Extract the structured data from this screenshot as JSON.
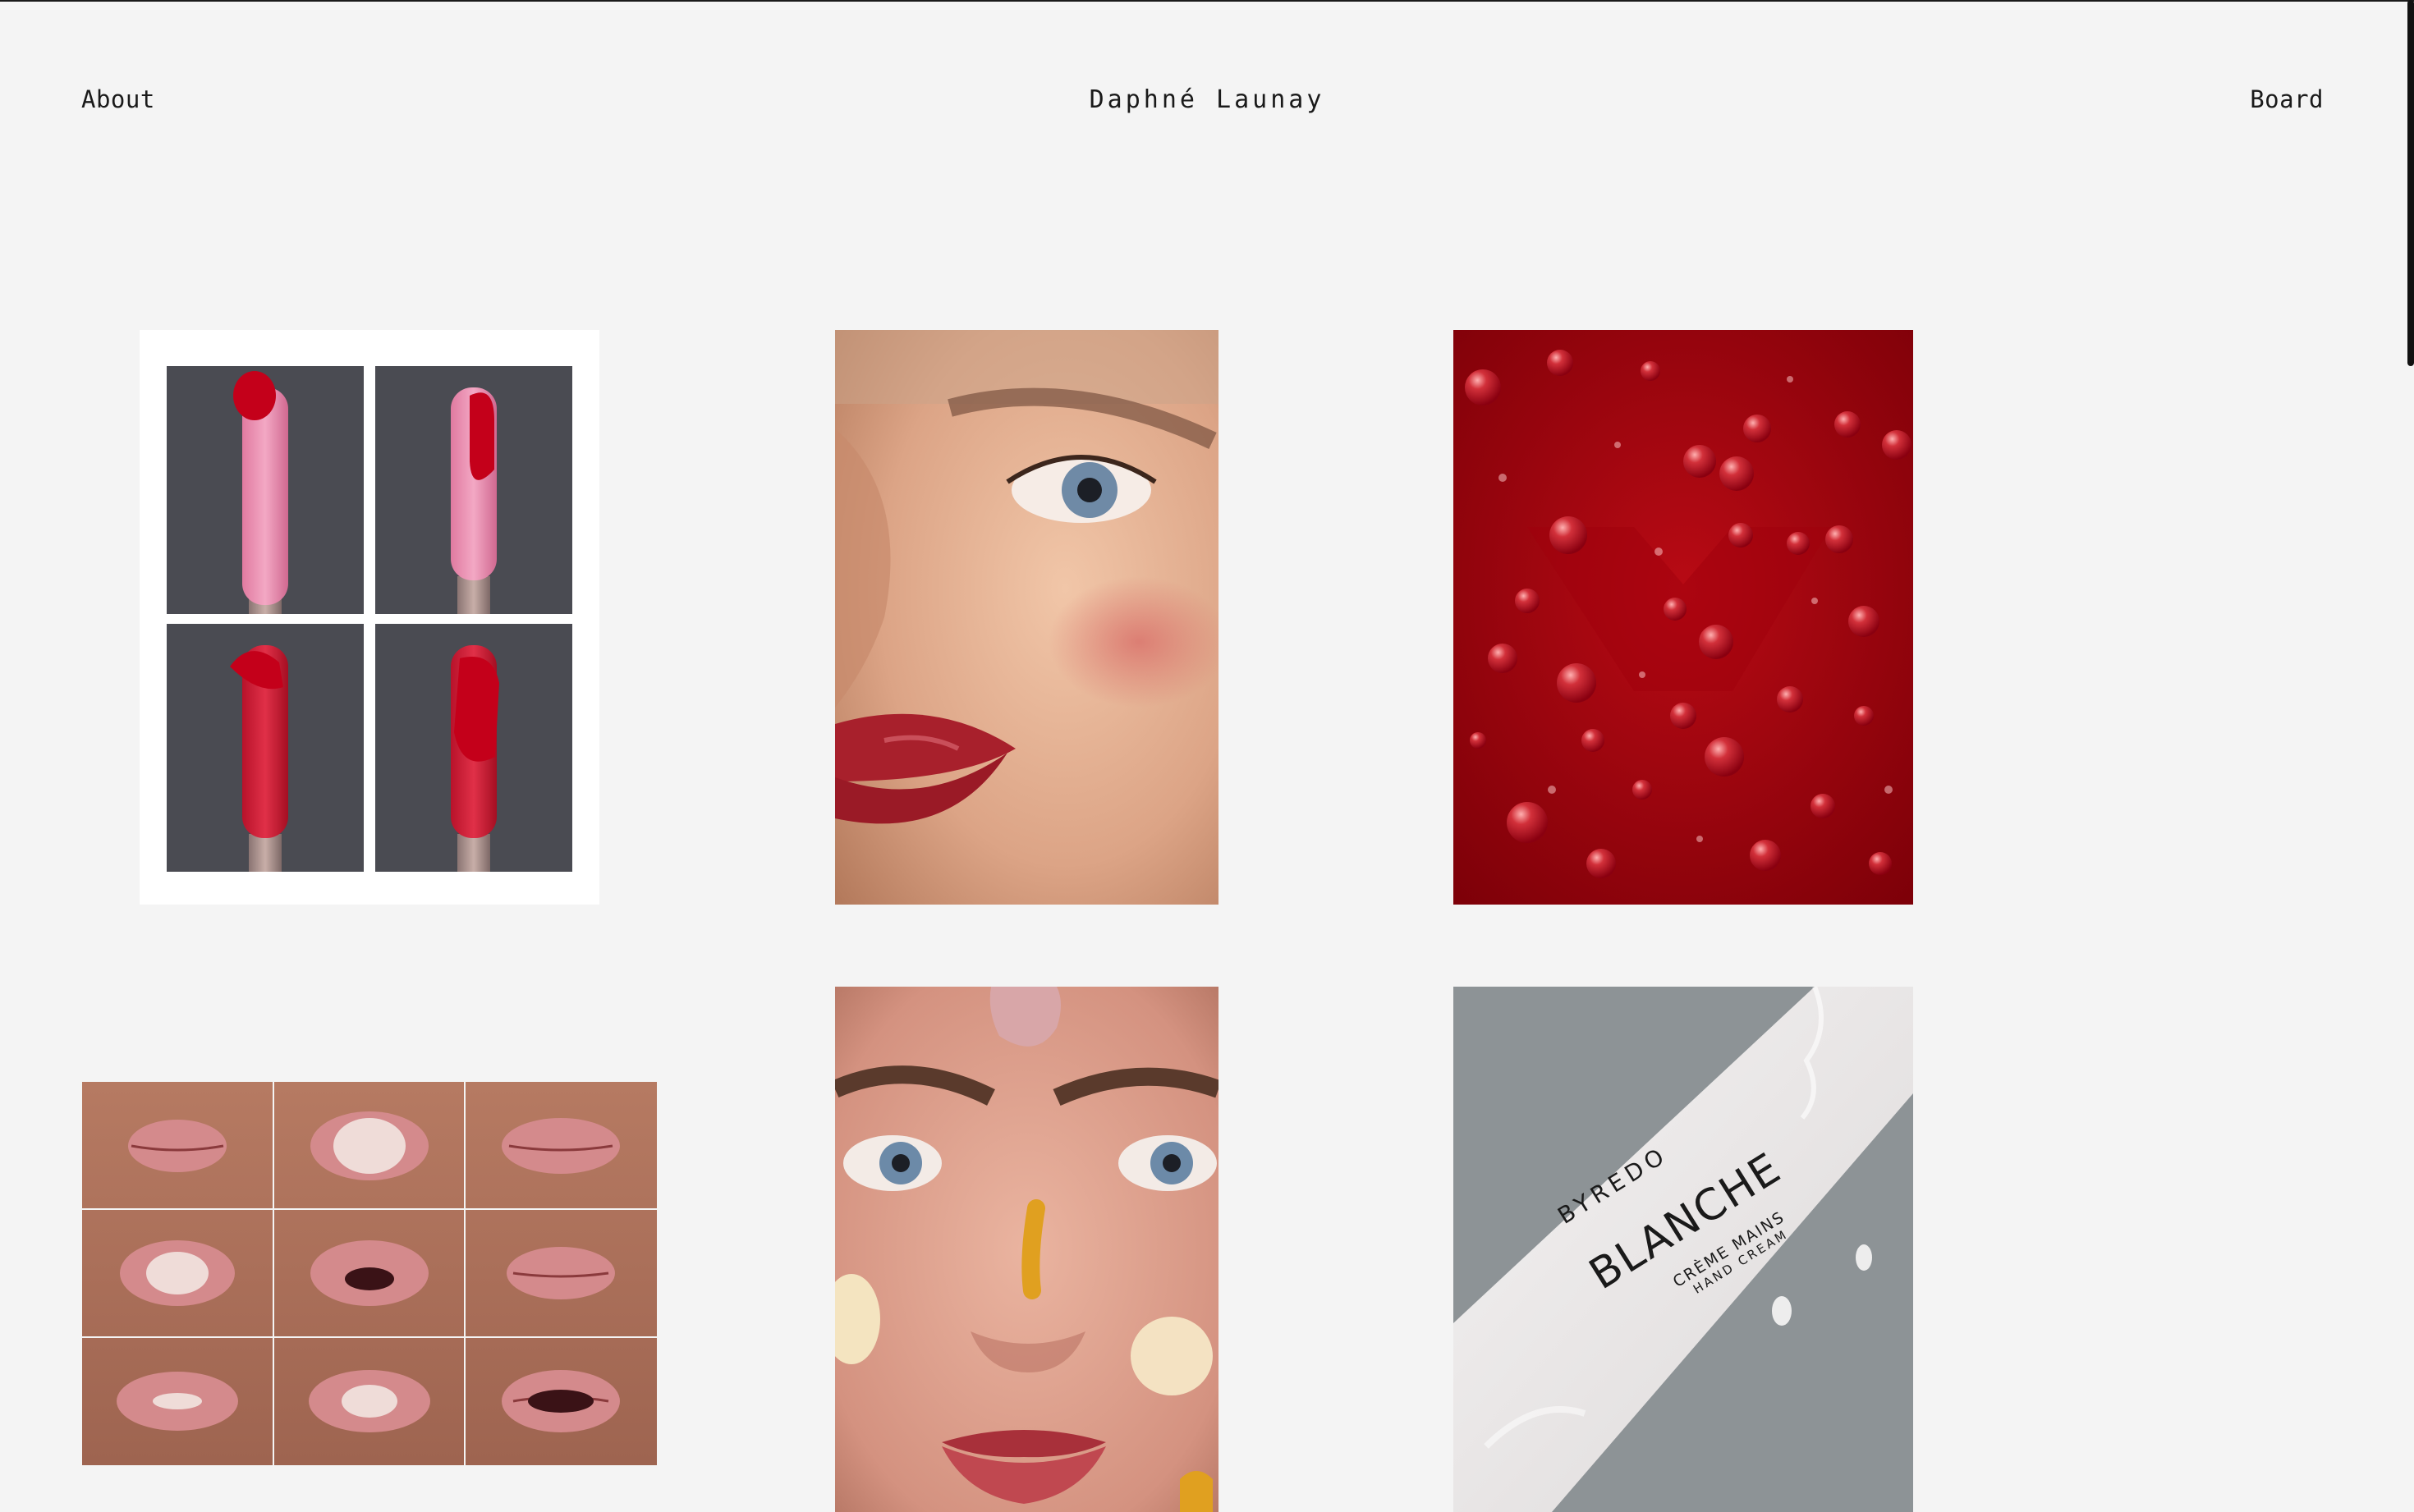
{
  "header": {
    "about_label": "About",
    "site_title": "Daphné Launay",
    "board_label": "Board"
  },
  "gallery": {
    "items": [
      {
        "name": "lipstick-swatch-grid",
        "icon": "image"
      },
      {
        "name": "face-closeup-portrait",
        "icon": "image"
      },
      {
        "name": "red-bubble-texture",
        "icon": "image"
      },
      {
        "name": "lips-bubblegum-grid",
        "icon": "image"
      },
      {
        "name": "face-cream-swatches-portrait",
        "icon": "image"
      },
      {
        "name": "hand-cream-tube",
        "icon": "image"
      }
    ],
    "product": {
      "brand": "BYREDO",
      "name": "BLANCHE",
      "subline1": "CRÈME MAINS",
      "subline2": "HAND CREAM"
    }
  },
  "colors": {
    "background": "#f4f4f4",
    "text": "#1a1a1a",
    "accent_red": "#b3000f",
    "slate": "#4a4b52",
    "tube_bg": "#8d9396"
  }
}
